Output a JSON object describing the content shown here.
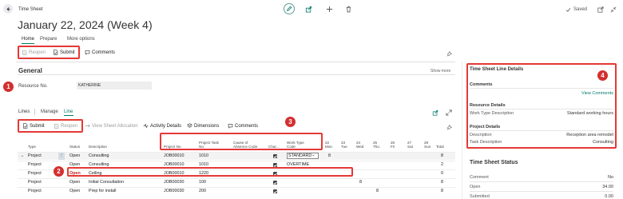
{
  "header": {
    "app_title": "Time Sheet",
    "page_title": "January 22, 2024 (Week 4)",
    "saved_label": "Saved"
  },
  "action_tabs": [
    "Home",
    "Prepare",
    "More options"
  ],
  "toolbar": {
    "reopen": "Reopen",
    "submit": "Submit",
    "comments": "Comments"
  },
  "general": {
    "title": "General",
    "show_more": "Show more",
    "resource_label": "Resource No.",
    "resource_value": "KATHERINE"
  },
  "lines": {
    "tabs": [
      "Lines",
      "Manage",
      "Line"
    ],
    "toolbar": {
      "submit": "Submit",
      "reopen": "Reopen",
      "view_allocation": "View Sheet Allocation",
      "activity_details": "Activity Details",
      "dimensions": "Dimensions",
      "comments": "Comments"
    },
    "columns": {
      "type": "Type",
      "status": "Status",
      "description": "Description",
      "project_no": "Project No.",
      "project_task_1": "Project Task",
      "project_task_2": "No.",
      "cause_1": "Cause of",
      "cause_2": "Absence Code",
      "chargeable": "Char...",
      "work_type_1": "Work Type",
      "work_type_2": "Code",
      "total": "Total"
    },
    "days": [
      {
        "num": "22",
        "name": "Mon"
      },
      {
        "num": "23",
        "name": "Tue"
      },
      {
        "num": "24",
        "name": "Wed"
      },
      {
        "num": "25",
        "name": "Thu"
      },
      {
        "num": "26",
        "name": "Fri"
      },
      {
        "num": "27",
        "name": "Sat"
      },
      {
        "num": "28",
        "name": "Sun"
      }
    ],
    "rows": [
      {
        "type": "Project",
        "status": "Open",
        "description": "Consulting",
        "project_no": "JOB00010",
        "task": "1010",
        "work_type": "STANDARD",
        "day_value": "8",
        "total": "8"
      },
      {
        "type": "Project",
        "status": "Open",
        "description": "Consulting",
        "project_no": "JOB00010",
        "task": "1010",
        "work_type": "OVERTIME",
        "day_value": "",
        "total": "2"
      },
      {
        "type": "Project",
        "status": "Open",
        "description": "Ceiling",
        "project_no": "JOB00010",
        "task": "1220",
        "work_type": "",
        "day_value": "",
        "total": "0"
      },
      {
        "type": "Project",
        "status": "Open",
        "description": "Initial Consultation",
        "project_no": "JOB00030",
        "task": "100",
        "work_type": "",
        "day_value": "8",
        "total": "8"
      },
      {
        "type": "Project",
        "status": "Open",
        "description": "Prep for install",
        "project_no": "JOB00030",
        "task": "200",
        "work_type": "",
        "day_value": "8",
        "total": "8"
      }
    ]
  },
  "pane": {
    "title": "Time Sheet Line Details",
    "comments_label": "Comments",
    "view_comments": "View Comments",
    "resource_details": "Resource Details",
    "work_type_desc_label": "Work Type Description",
    "work_type_desc_value": "Standard working hours",
    "project_details": "Project Details",
    "description_label": "Description",
    "description_value": "Reception area remodel",
    "task_desc_label": "Task Description",
    "task_desc_value": "Consulting",
    "status_title": "Time Sheet Status",
    "comment_label": "Comment",
    "comment_value": "No",
    "open_label": "Open",
    "open_value": "34.00",
    "submitted_label": "Submitted",
    "submitted_value": "0.00"
  },
  "badges": [
    "1",
    "2",
    "3",
    "4"
  ],
  "colors": {
    "accent": "#00796b",
    "callout": "#e53935",
    "badge": "#d32f2f"
  }
}
